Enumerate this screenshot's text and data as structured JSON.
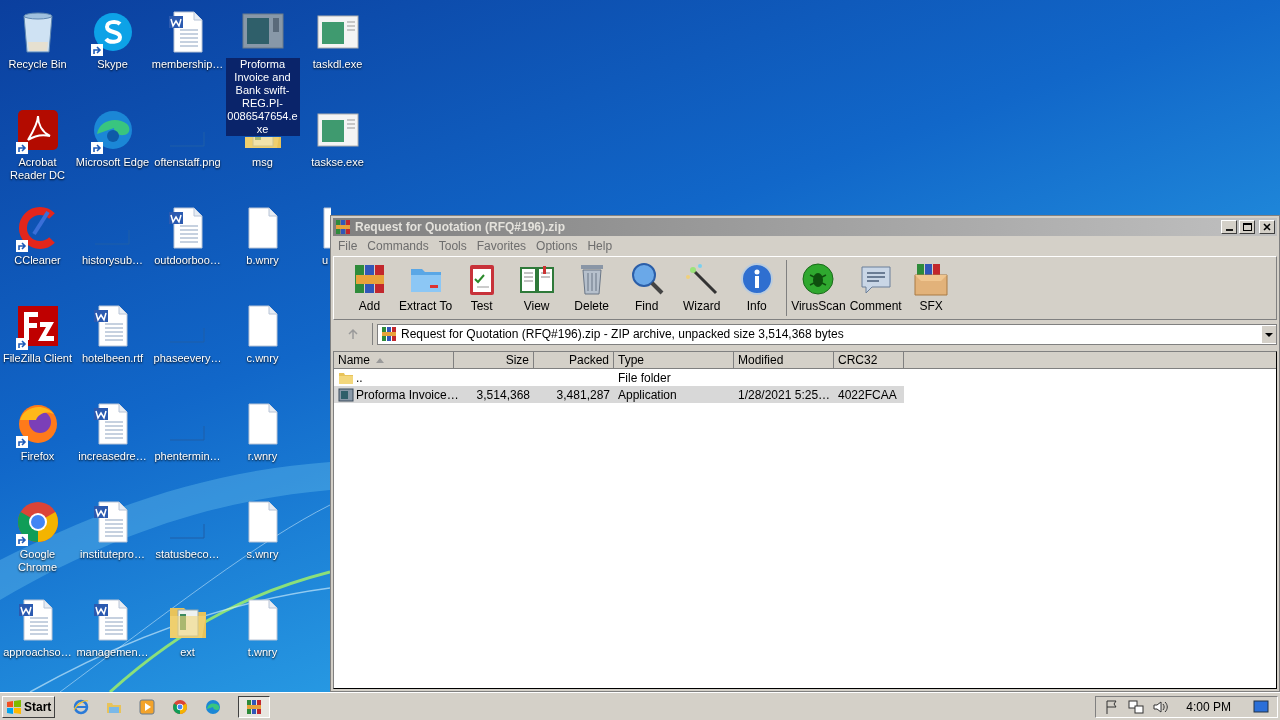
{
  "desktop_icons": [
    {
      "label": "Recycle Bin",
      "kind": "recycle",
      "shortcut": false,
      "selected": false
    },
    {
      "label": "Acrobat Reader DC",
      "kind": "acrobat",
      "shortcut": true,
      "selected": false
    },
    {
      "label": "CCleaner",
      "kind": "ccleaner",
      "shortcut": true,
      "selected": false
    },
    {
      "label": "FileZilla Client",
      "kind": "filezilla",
      "shortcut": true,
      "selected": false
    },
    {
      "label": "Firefox",
      "kind": "firefox",
      "shortcut": true,
      "selected": false
    },
    {
      "label": "Google Chrome",
      "kind": "chrome",
      "shortcut": true,
      "selected": false
    },
    {
      "label": "approachso…",
      "kind": "word",
      "shortcut": false,
      "selected": false
    },
    {
      "label": "Skype",
      "kind": "skype",
      "shortcut": true,
      "selected": false
    },
    {
      "label": "Microsoft Edge",
      "kind": "edge",
      "shortcut": true,
      "selected": false
    },
    {
      "label": "historysub…",
      "kind": "blank",
      "shortcut": false,
      "selected": false
    },
    {
      "label": "hotelbeen.rtf",
      "kind": "word",
      "shortcut": false,
      "selected": false
    },
    {
      "label": "increasedre…",
      "kind": "word",
      "shortcut": false,
      "selected": false
    },
    {
      "label": "institutepro…",
      "kind": "word",
      "shortcut": false,
      "selected": false
    },
    {
      "label": "managemen…",
      "kind": "word",
      "shortcut": false,
      "selected": false
    },
    {
      "label": "membership…",
      "kind": "word",
      "shortcut": false,
      "selected": false
    },
    {
      "label": "oftenstaff.png",
      "kind": "blank",
      "shortcut": false,
      "selected": false
    },
    {
      "label": "outdoorboo…",
      "kind": "word",
      "shortcut": false,
      "selected": false
    },
    {
      "label": "phaseevery…",
      "kind": "blank",
      "shortcut": false,
      "selected": false
    },
    {
      "label": "phentermin…",
      "kind": "blank",
      "shortcut": false,
      "selected": false
    },
    {
      "label": "statusbeco…",
      "kind": "blank",
      "shortcut": false,
      "selected": false
    },
    {
      "label": "ext",
      "kind": "folder",
      "shortcut": false,
      "selected": false
    },
    {
      "label": "Proforma Invoice and Bank swift-REG.PI-0086547654.exe",
      "kind": "exe_grey",
      "shortcut": false,
      "selected": true
    },
    {
      "label": "msg",
      "kind": "folder",
      "shortcut": false,
      "selected": false
    },
    {
      "label": "b.wnry",
      "kind": "file",
      "shortcut": false,
      "selected": false
    },
    {
      "label": "c.wnry",
      "kind": "file",
      "shortcut": false,
      "selected": false
    },
    {
      "label": "r.wnry",
      "kind": "file",
      "shortcut": false,
      "selected": false
    },
    {
      "label": "s.wnry",
      "kind": "file",
      "shortcut": false,
      "selected": false
    },
    {
      "label": "t.wnry",
      "kind": "file",
      "shortcut": false,
      "selected": false
    },
    {
      "label": "taskdl.exe",
      "kind": "exe",
      "shortcut": false,
      "selected": false
    },
    {
      "label": "taskse.exe",
      "kind": "exe",
      "shortcut": false,
      "selected": false
    },
    {
      "label": "u",
      "kind": "file",
      "shortcut": false,
      "selected": false,
      "cut": true
    }
  ],
  "window": {
    "title": "Request for Quotation (RFQ#196).zip",
    "active": false,
    "menu": [
      "File",
      "Commands",
      "Tools",
      "Favorites",
      "Options",
      "Help"
    ],
    "toolbar_groups": [
      {
        "buttons": [
          {
            "label": "Add",
            "kind": "add"
          },
          {
            "label": "Extract To",
            "kind": "extract"
          },
          {
            "label": "Test",
            "kind": "test"
          },
          {
            "label": "View",
            "kind": "view"
          },
          {
            "label": "Delete",
            "kind": "delete"
          },
          {
            "label": "Find",
            "kind": "find"
          },
          {
            "label": "Wizard",
            "kind": "wizard"
          },
          {
            "label": "Info",
            "kind": "info"
          }
        ]
      },
      {
        "buttons": [
          {
            "label": "VirusScan",
            "kind": "virus"
          },
          {
            "label": "Comment",
            "kind": "comment"
          },
          {
            "label": "SFX",
            "kind": "sfx"
          }
        ]
      }
    ],
    "address": "Request for Quotation (RFQ#196).zip - ZIP archive, unpacked size 3,514,368 bytes",
    "table": {
      "columns": [
        {
          "label": "Name",
          "sorted": true
        },
        {
          "label": "Size",
          "sorted": false
        },
        {
          "label": "Packed",
          "sorted": false
        },
        {
          "label": "Type",
          "sorted": false
        },
        {
          "label": "Modified",
          "sorted": false
        },
        {
          "label": "CRC32",
          "sorted": false
        }
      ],
      "rows": [
        {
          "kind": "folder",
          "selected": false,
          "name": "..",
          "type": "File folder"
        },
        {
          "kind": "exe",
          "selected": true,
          "name": "Proforma Invoice…",
          "size": "3,514,368",
          "packed": "3,481,287",
          "type": "Application",
          "modified": "1/28/2021 5:25…",
          "crc32": "4022FCAA"
        }
      ]
    }
  },
  "taskbar": {
    "start": "Start",
    "apps": [
      {
        "kind": "ie",
        "active": false
      },
      {
        "kind": "explorer",
        "active": false
      },
      {
        "kind": "media",
        "active": false
      },
      {
        "kind": "chrome",
        "active": false
      },
      {
        "kind": "edge",
        "active": false
      },
      {
        "kind": "winrar",
        "active": true
      }
    ],
    "clock": "4:00 PM"
  }
}
